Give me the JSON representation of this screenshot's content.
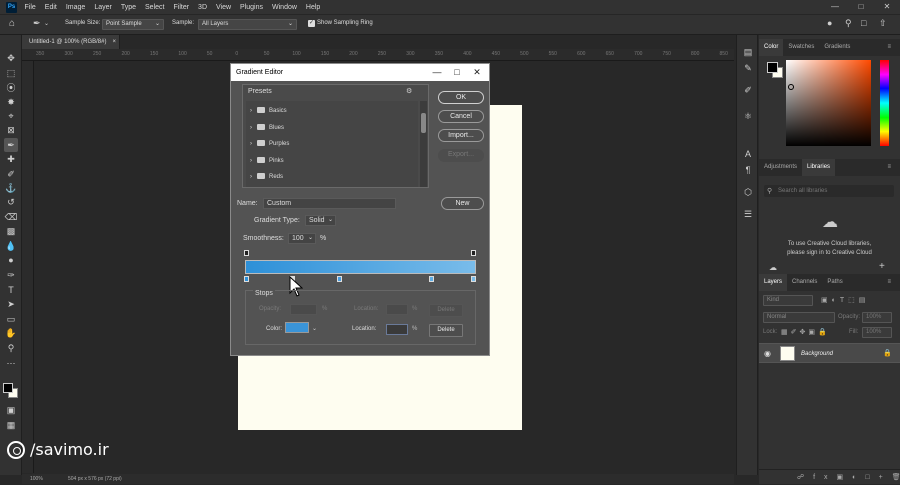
{
  "menubar": {
    "logo": "Ps",
    "items": [
      "File",
      "Edit",
      "Image",
      "Layer",
      "Type",
      "Select",
      "Filter",
      "3D",
      "View",
      "Plugins",
      "Window",
      "Help"
    ]
  },
  "options": {
    "sample_size_label": "Sample Size:",
    "sample_size_value": "Point Sample",
    "sample_label": "Sample:",
    "sample_value": "All Layers",
    "show_ring_label": "Show Sampling Ring"
  },
  "document": {
    "tab_title": "Untitled-1 @ 100% (RGB/8#)",
    "ruler_ticks": [
      "350",
      "300",
      "250",
      "200",
      "150",
      "100",
      "50",
      "0",
      "50",
      "100",
      "150",
      "200",
      "250",
      "300",
      "350",
      "400",
      "450",
      "500",
      "550",
      "600",
      "650",
      "700",
      "750",
      "800",
      "850"
    ],
    "status_zoom": "100%",
    "status_info": "504 px x 576 px (72 ppi)",
    "page_color": "#fefdf0"
  },
  "watermark": {
    "text": "/savimo.ir"
  },
  "dialog": {
    "title": "Gradient Editor",
    "presets_label": "Presets",
    "presets": [
      "Basics",
      "Blues",
      "Purples",
      "Pinks",
      "Reds"
    ],
    "ok_label": "OK",
    "cancel_label": "Cancel",
    "import_label": "Import...",
    "export_label": "Export...",
    "name_label": "Name:",
    "name_value": "Custom",
    "new_label": "New",
    "gradient_type_label": "Gradient Type:",
    "gradient_type_value": "Solid",
    "smoothness_label": "Smoothness:",
    "smoothness_value": "100",
    "smoothness_unit": "%",
    "gradient_start_color": "#2d90d8",
    "gradient_end_color": "#79bcea",
    "stops_label": "Stops",
    "opacity_label": "Opacity:",
    "opacity_unit": "%",
    "location_label_top": "Location:",
    "location_unit_top": "%",
    "delete_label_top": "Delete",
    "color_label": "Color:",
    "color_value": "#3a94d8",
    "location_label_bottom": "Location:",
    "location_unit_bottom": "%",
    "delete_label_bottom": "Delete"
  },
  "panels": {
    "color_tabs": [
      "Color",
      "Swatches",
      "Gradients"
    ],
    "library_tabs": [
      "Adjustments",
      "Libraries"
    ],
    "library_search_placeholder": "Search all libraries",
    "library_message_1": "To use Creative Cloud libraries,",
    "library_message_2": "please sign in to Creative Cloud",
    "layer_tabs": [
      "Layers",
      "Channels",
      "Paths"
    ],
    "layer_kind": "Kind",
    "blend_mode": "Normal",
    "opacity_label": "Opacity:",
    "opacity_value": "100%",
    "lock_label": "Lock:",
    "fill_label": "Fill:",
    "fill_value": "100%",
    "layer_name": "Background"
  }
}
